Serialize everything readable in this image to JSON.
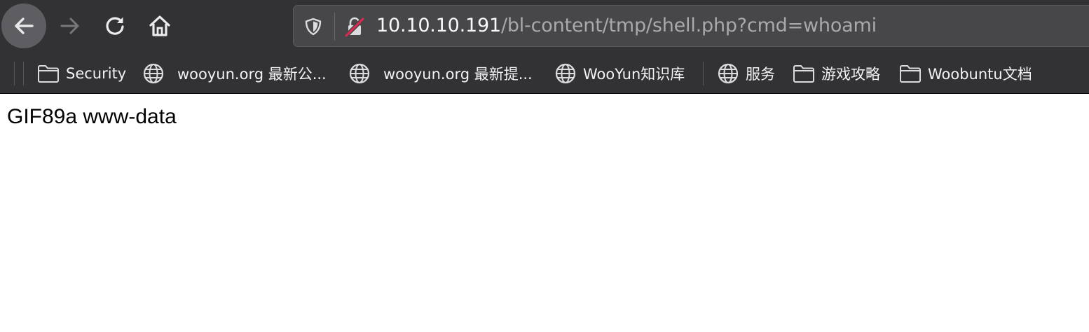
{
  "navigation": {
    "back_icon": "arrow-left-icon",
    "forward_icon": "arrow-right-icon",
    "reload_icon": "reload-icon",
    "home_icon": "home-icon"
  },
  "urlbar": {
    "shield_icon": "tracking-protection-shield-icon",
    "lock_icon": "insecure-lock-icon",
    "host": "10.10.10.191",
    "path": "/bl-content/tmp/shell.php?cmd=whoami"
  },
  "bookmarks": [
    {
      "label": "Security",
      "icon": "folder-icon"
    },
    {
      "label": "wooyun.org 最新公...",
      "icon": "globe-icon"
    },
    {
      "label": "wooyun.org 最新提...",
      "icon": "globe-icon"
    },
    {
      "label": "WooYun知识库",
      "icon": "globe-icon"
    },
    {
      "label": "服务",
      "icon": "globe-icon"
    },
    {
      "label": "游戏攻略",
      "icon": "folder-icon"
    },
    {
      "label": "Woobuntu文档",
      "icon": "folder-icon"
    }
  ],
  "page": {
    "body_text": "GIF89a www-data"
  },
  "colors": {
    "toolbar_bg": "#323234",
    "urlbar_bg": "#474749",
    "url_host": "#f9f9fa",
    "url_path": "#a9a9ad",
    "insecure_red": "#e22850"
  }
}
